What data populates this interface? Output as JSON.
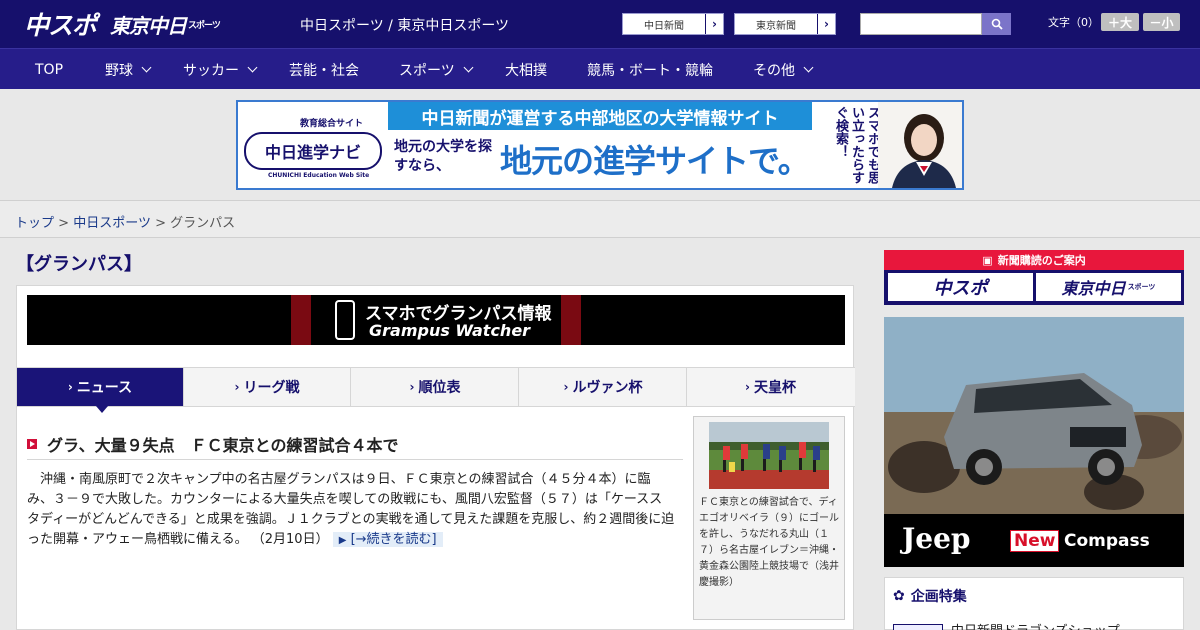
{
  "header": {
    "logo_chuspo": "中スポ",
    "logo_tokyo": "東京中日",
    "logo_tokyo_small": "スポーツ",
    "site_title": "中日スポーツ / 東京中日スポーツ",
    "ext_links": [
      "中日新聞",
      "東京新聞"
    ],
    "font_size_label": "文字（0）",
    "font_increase": "＋大",
    "font_decrease": "－小"
  },
  "nav": {
    "items": [
      {
        "label": "TOP",
        "dropdown": false
      },
      {
        "label": "野球",
        "dropdown": true
      },
      {
        "label": "サッカー",
        "dropdown": true
      },
      {
        "label": "芸能・社会",
        "dropdown": false
      },
      {
        "label": "スポーツ",
        "dropdown": true
      },
      {
        "label": "大相撲",
        "dropdown": false
      },
      {
        "label": "競馬・ボート・競輪",
        "dropdown": false
      },
      {
        "label": "その他",
        "dropdown": true
      }
    ]
  },
  "banner": {
    "logo_sub": "教育総合サイト",
    "logo": "中日進学ナビ",
    "logo_en": "CHUNICHI Education Web Site",
    "top_text": "中日新聞が運営する中部地区の大学情報サイト",
    "sub_text": "地元の大学を探すなら、",
    "main_text": "地元の進学サイトで。",
    "vertical_text": "スマホでも思い立ったらすぐ検索！"
  },
  "breadcrumb": {
    "items": [
      "トップ",
      "中日スポーツ"
    ],
    "current": "グランパス",
    "separator": ">"
  },
  "page_title": "【グランパス】",
  "grampus_banner": {
    "line1": "スマホでグランパス情報",
    "line2": "Grampus Watcher"
  },
  "tabs": [
    {
      "label": "ニュース",
      "active": true
    },
    {
      "label": "リーグ戦",
      "active": false
    },
    {
      "label": "順位表",
      "active": false
    },
    {
      "label": "ルヴァン杯",
      "active": false
    },
    {
      "label": "天皇杯",
      "active": false
    }
  ],
  "article": {
    "headline": "グラ、大量９失点　ＦＣ東京との練習試合４本で",
    "body": "　沖縄・南風原町で２次キャンプ中の名古屋グランパスは９日、ＦＣ東京との練習試合（４５分４本）に臨み、３－９で大敗した。カウンターによる大量失点を喫しての敗戦にも、風間八宏監督（５７）は「ケーススタディーがどんどんできる」と成果を強調。Ｊ１クラブとの実戦を通して見えた課題を克服し、約２週間後に迫った開幕・アウェー鳥栖戦に備える。",
    "date": "（2月10日）",
    "read_more": "[→続きを読む]",
    "photo_caption": "ＦＣ東京との練習試合で、ディエゴオリベイラ（９）にゴールを許し、うなだれる丸山（１７）ら名古屋イレブン＝沖縄・黄金森公園陸上競技場で（浅井慶撮影）"
  },
  "sidebar": {
    "subscription_title": "新聞購読のご案内",
    "sub_chuspo": "中スポ",
    "sub_tokyo": "東京中日",
    "sub_tokyo_small": "スポーツ",
    "jeep_logo": "Jeep",
    "jeep_new": "New",
    "jeep_model": "Compass",
    "feature_title": "企画特集",
    "feature_item": "中日新聞ドラゴンズショップ"
  },
  "colors": {
    "header_bg": "#16106c",
    "nav_bg": "#261d8a",
    "accent_red": "#e8173c",
    "banner_blue": "#1e8fd8"
  }
}
